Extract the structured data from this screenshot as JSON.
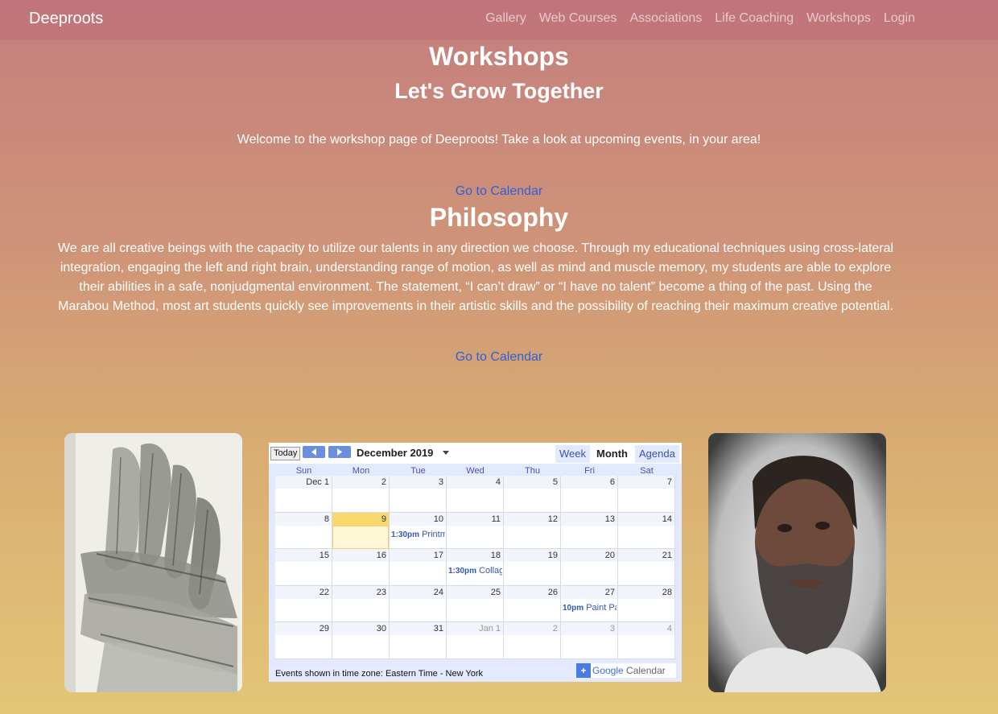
{
  "nav": {
    "brand": "Deeproots",
    "links": [
      "Gallery",
      "Web Courses",
      "Associations",
      "Life Coaching",
      "Workshops",
      "Login"
    ]
  },
  "header": {
    "title": "Workshops",
    "subtitle": "Let's Grow Together",
    "welcome": "Welcome to the workshop page of Deeproots! Take a look at upcoming events, in your area!"
  },
  "links": {
    "calendar": "Go to Calendar"
  },
  "philosophy": {
    "title": "Philosophy",
    "text": "We are all creative beings with the capacity to utilize our talents in any direction we choose. Through my educational techniques using cross-lateral integration, engaging the left and right brain, understanding range of motion, as well as mind and muscle memory, my students are able to explore their abilities in a safe, nonjudgmental environment. The statement, “I can’t draw” or “I have no talent” become a thing of the past. Using the Marabou Method, most art students quickly see improvements in their artistic skills and the possibility of reaching their maximum creative potential."
  },
  "calendar": {
    "today_label": "Today",
    "month_title": "December 2019",
    "views": [
      "Week",
      "Month",
      "Agenda"
    ],
    "days_of_week": [
      "Sun",
      "Mon",
      "Tue",
      "Wed",
      "Thu",
      "Fri",
      "Sat"
    ],
    "weeks": [
      [
        "Dec 1",
        "2",
        "3",
        "4",
        "5",
        "6",
        "7"
      ],
      [
        "8",
        "9",
        "10",
        "11",
        "12",
        "13",
        "14"
      ],
      [
        "15",
        "16",
        "17",
        "18",
        "19",
        "20",
        "21"
      ],
      [
        "22",
        "23",
        "24",
        "25",
        "26",
        "27",
        "28"
      ],
      [
        "29",
        "30",
        "31",
        "Jan 1",
        "2",
        "3",
        "4"
      ]
    ],
    "events": [
      {
        "time": "1:30pm",
        "title": "Printmaking"
      },
      {
        "time": "1:30pm",
        "title": "Collage"
      },
      {
        "time": "10pm",
        "title": "Paint Party"
      }
    ],
    "footer": "Events shown in time zone: Eastern Time - New York",
    "brand_google": "Google",
    "brand_calendar": "Calendar",
    "colors": {
      "today": "#f9d96e",
      "header": "#e3e9ff",
      "event": "#3358b0"
    }
  },
  "images": {
    "left": "hands-sketch",
    "right": "instructor-portrait"
  }
}
